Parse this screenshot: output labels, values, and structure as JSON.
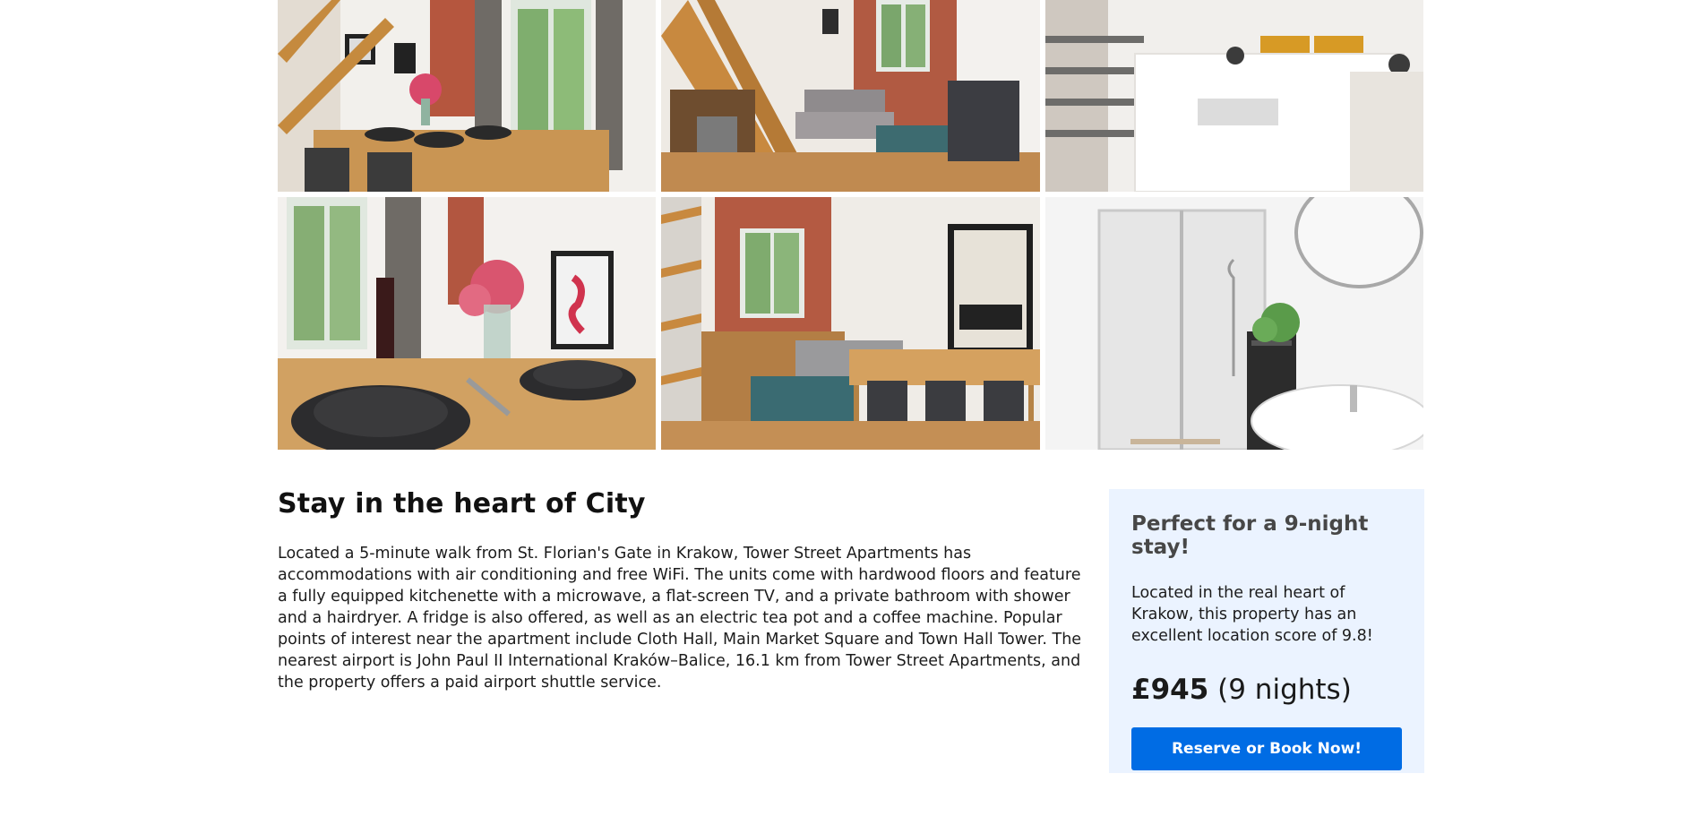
{
  "gallery": {
    "photos": [
      {
        "icon": "dining-room-photo"
      },
      {
        "icon": "living-room-stairs-photo"
      },
      {
        "icon": "mezzanine-bedroom-photo"
      },
      {
        "icon": "table-setting-photo"
      },
      {
        "icon": "living-dining-area-photo"
      },
      {
        "icon": "bathroom-shower-photo"
      }
    ]
  },
  "content": {
    "title": "Stay in the heart of City",
    "description": "Located a 5-minute walk from St. Florian's Gate in Krakow, Tower Street Apartments has accommodations with air conditioning and free WiFi. The units come with hardwood floors and feature a fully equipped kitchenette with a microwave, a flat-screen TV, and a private bathroom with shower and a hairdryer. A fridge is also offered, as well as an electric tea pot and a coffee machine. Popular points of interest near the apartment include Cloth Hall, Main Market Square and Town Hall Tower. The nearest airport is John Paul II International Kraków–Balice, 16.1 km from Tower Street Apartments, and the property offers a paid airport shuttle service."
  },
  "card": {
    "heading": "Perfect for a 9-night stay!",
    "description": "Located in the real heart of Krakow, this property has an excellent location score of 9.8!",
    "price": "£945",
    "nights": "(9 nights)",
    "button_label": "Reserve or Book Now!"
  },
  "colors": {
    "accent": "#006ce4",
    "card_bg": "#ebf3ff"
  }
}
